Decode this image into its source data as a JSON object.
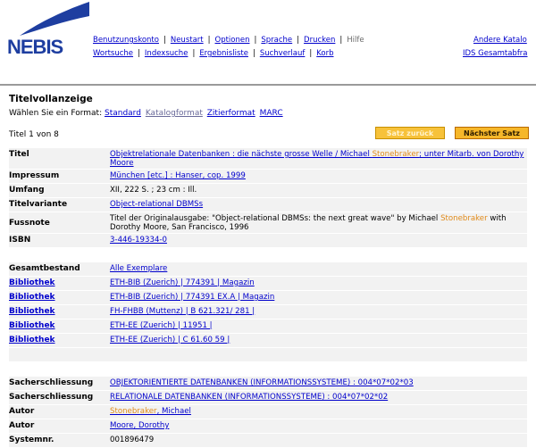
{
  "header": {
    "logo_text": "NEBIS",
    "nav_row1": [
      "Benutzungskonto",
      "Neustart",
      "Optionen",
      "Sprache",
      "Drucken",
      "Hilfe"
    ],
    "nav_row2": [
      "Wortsuche",
      "Indexsuche",
      "Ergebnisliste",
      "Suchverlauf",
      "Korb"
    ],
    "right_row1": "Andere Katalo",
    "right_row2": "IDS Gesamtabfra",
    "colors": {
      "logo": "#1e3ea0",
      "link": "#0000cc",
      "highlight": "#e08a1a",
      "button": "#f6b72a"
    }
  },
  "page": {
    "title": "Titelvollanzeige",
    "format_prefix": "Wählen Sie ein Format:",
    "formats": [
      "Standard",
      "Katalogformat",
      "Zitierformat",
      "MARC"
    ],
    "count": "Titel 1 von 8",
    "btn_prev": "Satz zurück",
    "btn_next": "Nächster Satz"
  },
  "record": {
    "titel_label": "Titel",
    "titel_a": "Objektrelationale Datenbanken : die nächste grosse Welle / Michael ",
    "titel_hl": "Stonebraker",
    "titel_b": "; unter Mitarb. von Dorothy Moore",
    "impressum_label": "Impressum",
    "impressum": "München [etc.] : Hanser, cop. 1999",
    "umfang_label": "Umfang",
    "umfang": "XII, 222 S. ; 23 cm : Ill.",
    "titelvariante_label": "Titelvariante",
    "titelvariante": "Object-relational DBMSs",
    "fussnote_label": "Fussnote",
    "fussnote_a": "Titel der Originalausgabe: \"Object-relational DBMSs: the next great wave\" by Michael ",
    "fussnote_hl": "Stonebraker",
    "fussnote_b": " with Dorothy Moore, San Francisco, 1996",
    "isbn_label": "ISBN",
    "isbn": "3-446-19334-0",
    "gesamtbestand_label": "Gesamtbestand",
    "gesamtbestand": "Alle Exemplare",
    "holdings_label": "Bibliothek",
    "holdings": [
      "ETH-BIB (Zuerich) | 774391 | Magazin",
      "ETH-BIB (Zuerich) | 774391 EX.A | Magazin",
      "FH-FHBB (Muttenz) | B 621.321/ 281 |",
      "ETH-EE (Zuerich) | 11951 |",
      "ETH-EE (Zuerich) | C 61.60 59 |"
    ],
    "sach_label": "Sacherschliessung",
    "sach1": "OBJEKTORIENTIERTE DATENBANKEN (INFORMATIONSSYSTEME) : 004*07*02*03",
    "sach2": "RELATIONALE DATENBANKEN (INFORMATIONSSYSTEME) : 004*07*02*02",
    "autor_label": "Autor",
    "autor1_hl": "Stonebraker",
    "autor1_b": ", Michael",
    "autor2": "Moore, Dorothy",
    "systemnr_label": "Systemnr.",
    "systemnr": "001896479"
  }
}
